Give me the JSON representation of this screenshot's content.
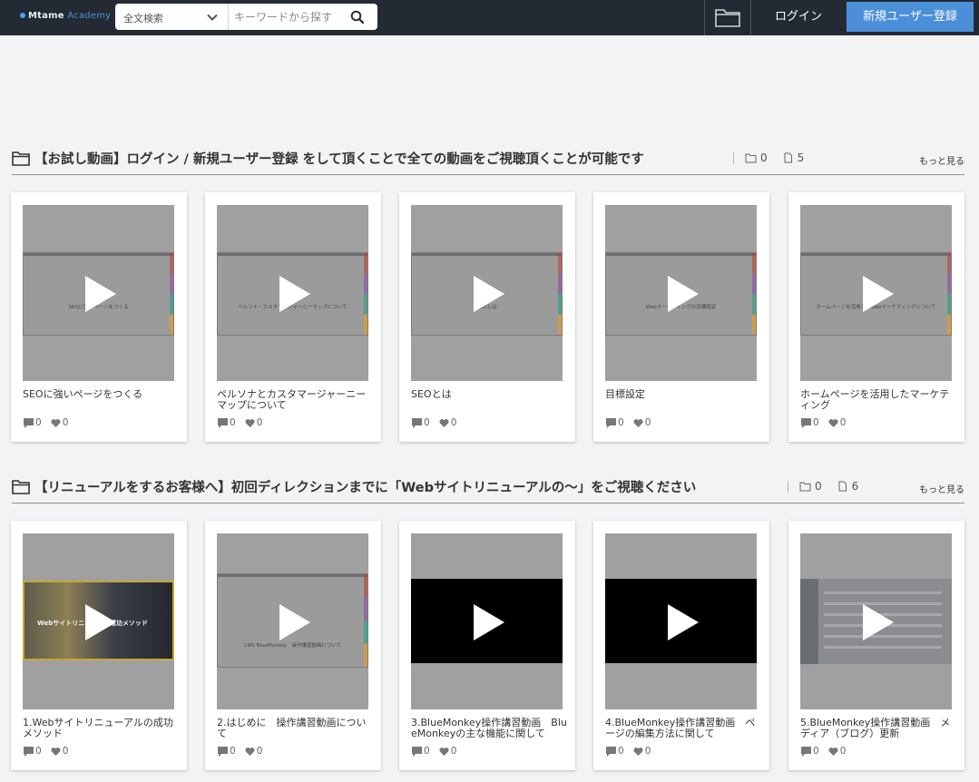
{
  "header": {
    "logo_main": "Mtame",
    "logo_sub": "Academy",
    "search_scope": "全文検索",
    "search_placeholder": "キーワードから探す",
    "login": "ログイン",
    "register": "新規ユーザー登録"
  },
  "sections": [
    {
      "title": "【お試し動画】ログイン / 新規ユーザー登録 をして頂くことで全ての動画をご視聴頂くことが可能です",
      "folders": "0",
      "files": "5",
      "more": "もっと見る",
      "cards": [
        {
          "title": "SEOに強いページをつくる",
          "comments": "0",
          "likes": "0",
          "thumb_text": "SEOに強いページをつくる"
        },
        {
          "title": "ペルソナとカスタマージャーニーマップについて",
          "comments": "0",
          "likes": "0",
          "thumb_text": "ペルソナ・カスタマージャーニーマップについて"
        },
        {
          "title": "SEOとは",
          "comments": "0",
          "likes": "0",
          "thumb_text": "SEOとは"
        },
        {
          "title": "目標設定",
          "comments": "0",
          "likes": "0",
          "thumb_text": "Webマーケティングの目標設定"
        },
        {
          "title": "ホームページを活用したマーケティング",
          "comments": "0",
          "likes": "0",
          "thumb_text": "ホームページを活用したWebマーケティングについて"
        }
      ]
    },
    {
      "title": "【リニューアルをするお客様へ】初回ディレクションまでに「Webサイトリニューアルの〜」をご視聴ください",
      "folders": "0",
      "files": "6",
      "more": "もっと見る",
      "cards": [
        {
          "title": "1.Webサイトリニューアルの成功メソッド",
          "comments": "0",
          "likes": "0",
          "thumb_text": "Webサイトリニューアル成功メソッド"
        },
        {
          "title": "2.はじめに　操作講習動画について",
          "comments": "0",
          "likes": "0",
          "thumb_text": "CMS BlueMonkey　操作講習動画について"
        },
        {
          "title": "3.BlueMonkey操作講習動画　BlueMonkeyの主な機能に関して",
          "comments": "0",
          "likes": "0",
          "thumb_text": ""
        },
        {
          "title": "4.BlueMonkey操作講習動画　ページの編集方法に関して",
          "comments": "0",
          "likes": "0",
          "thumb_text": ""
        },
        {
          "title": "5.BlueMonkey操作講習動画　メディア（ブログ）更新",
          "comments": "0",
          "likes": "0",
          "thumb_text": ""
        }
      ]
    }
  ],
  "colors": {
    "topbar": "#232a33",
    "accent": "#4b8fd9",
    "page_bg": "#f3f2f4"
  }
}
